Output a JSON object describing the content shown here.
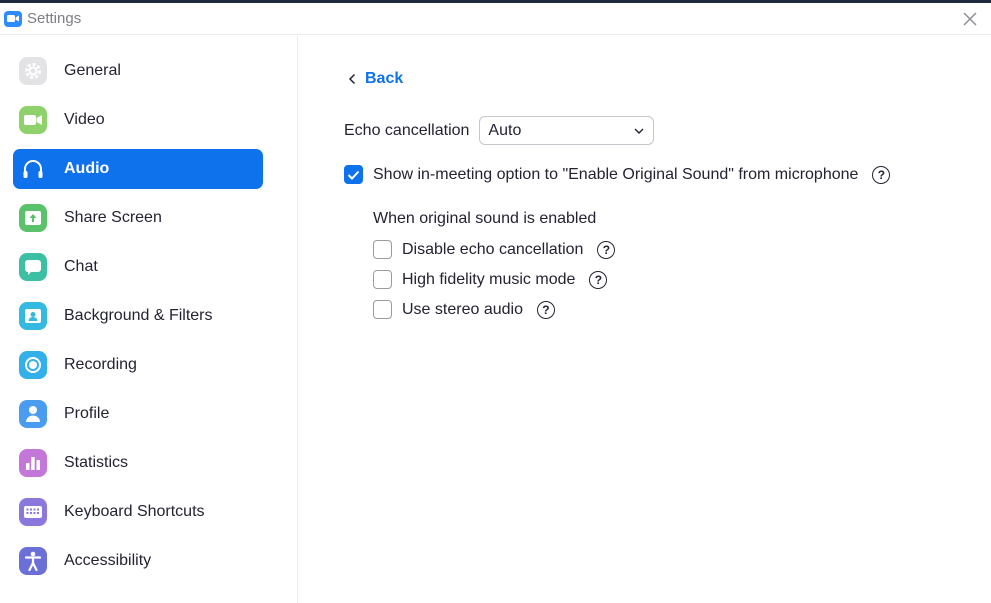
{
  "window": {
    "title": "Settings"
  },
  "sidebar": {
    "items": [
      {
        "label": "General",
        "icon": "gear-icon",
        "color": "#e3e3e6",
        "active": false
      },
      {
        "label": "Video",
        "icon": "video-camera-icon",
        "color": "#8fd16a",
        "active": false
      },
      {
        "label": "Audio",
        "icon": "headphones-icon",
        "color": "#0e72ed",
        "active": true
      },
      {
        "label": "Share Screen",
        "icon": "share-screen-icon",
        "color": "#5ac26a",
        "active": false
      },
      {
        "label": "Chat",
        "icon": "chat-icon",
        "color": "#3cbfa3",
        "active": false
      },
      {
        "label": "Background & Filters",
        "icon": "background-icon",
        "color": "#35b9e0",
        "active": false
      },
      {
        "label": "Recording",
        "icon": "recording-icon",
        "color": "#33b0ea",
        "active": false
      },
      {
        "label": "Profile",
        "icon": "profile-icon",
        "color": "#4a9cf0",
        "active": false
      },
      {
        "label": "Statistics",
        "icon": "statistics-icon",
        "color": "#c277d9",
        "active": false
      },
      {
        "label": "Keyboard Shortcuts",
        "icon": "keyboard-icon",
        "color": "#8b78dc",
        "active": false
      },
      {
        "label": "Accessibility",
        "icon": "accessibility-icon",
        "color": "#6b6fd8",
        "active": false
      }
    ]
  },
  "main": {
    "back_label": "Back",
    "echo": {
      "label": "Echo cancellation",
      "value": "Auto"
    },
    "original_sound": {
      "label": "Show in-meeting option to \"Enable Original Sound\" from microphone",
      "checked": true
    },
    "sub_heading": "When original sound is enabled",
    "options": [
      {
        "label": "Disable echo cancellation",
        "checked": false
      },
      {
        "label": "High fidelity music mode",
        "checked": false
      },
      {
        "label": "Use stereo audio",
        "checked": false
      }
    ],
    "help_glyph": "?"
  },
  "colors": {
    "accent": "#0e72ed",
    "text": "#232333",
    "muted": "#7c7c85"
  }
}
